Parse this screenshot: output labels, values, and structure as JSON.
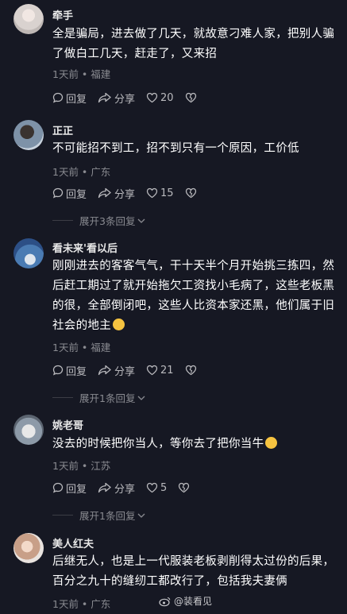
{
  "comments": [
    {
      "username": "牵手",
      "text": "全是骗局，进去做了几天，就故意刁难人家，把别人骗了做白工几天，赶走了，又来招",
      "time": "1天前",
      "location": "福建",
      "reply_label": "回复",
      "share_label": "分享",
      "likes": "20"
    },
    {
      "username": "正正",
      "text": "不可能招不到工，招不到只有一个原因，工价低",
      "time": "1天前",
      "location": "广东",
      "reply_label": "回复",
      "share_label": "分享",
      "likes": "15",
      "expand_label": "展开3条回复"
    },
    {
      "username": "看未来'看以后",
      "text": "刚刚进去的客客气气，干十天半个月开始挑三拣四，然后赶工期过了就开始拖欠工资找小毛病了，这些老板黑的很，全部倒闭吧，这些人比资本家还黑，他们属于旧社会的地主",
      "time": "1天前",
      "location": "福建",
      "reply_label": "回复",
      "share_label": "分享",
      "likes": "21",
      "expand_label": "展开1条回复"
    },
    {
      "username": "姚老哥",
      "text": "没去的时候把你当人，等你去了把你当牛",
      "time": "1天前",
      "location": "江苏",
      "reply_label": "回复",
      "share_label": "分享",
      "likes": "5",
      "expand_label": "展开1条回复"
    },
    {
      "username": "美人红夫",
      "text": "后继无人，也是上一代服装老板剥削得太过份的后果，百分之九十的缝纫工都改行了，包括我夫妻俩",
      "time": "1天前",
      "location": "广东"
    }
  ],
  "meta_separator": " • ",
  "watermark": "@装看见",
  "colors": {
    "background": "#161823",
    "text": "#ffffff",
    "muted": "#8a8b91"
  }
}
